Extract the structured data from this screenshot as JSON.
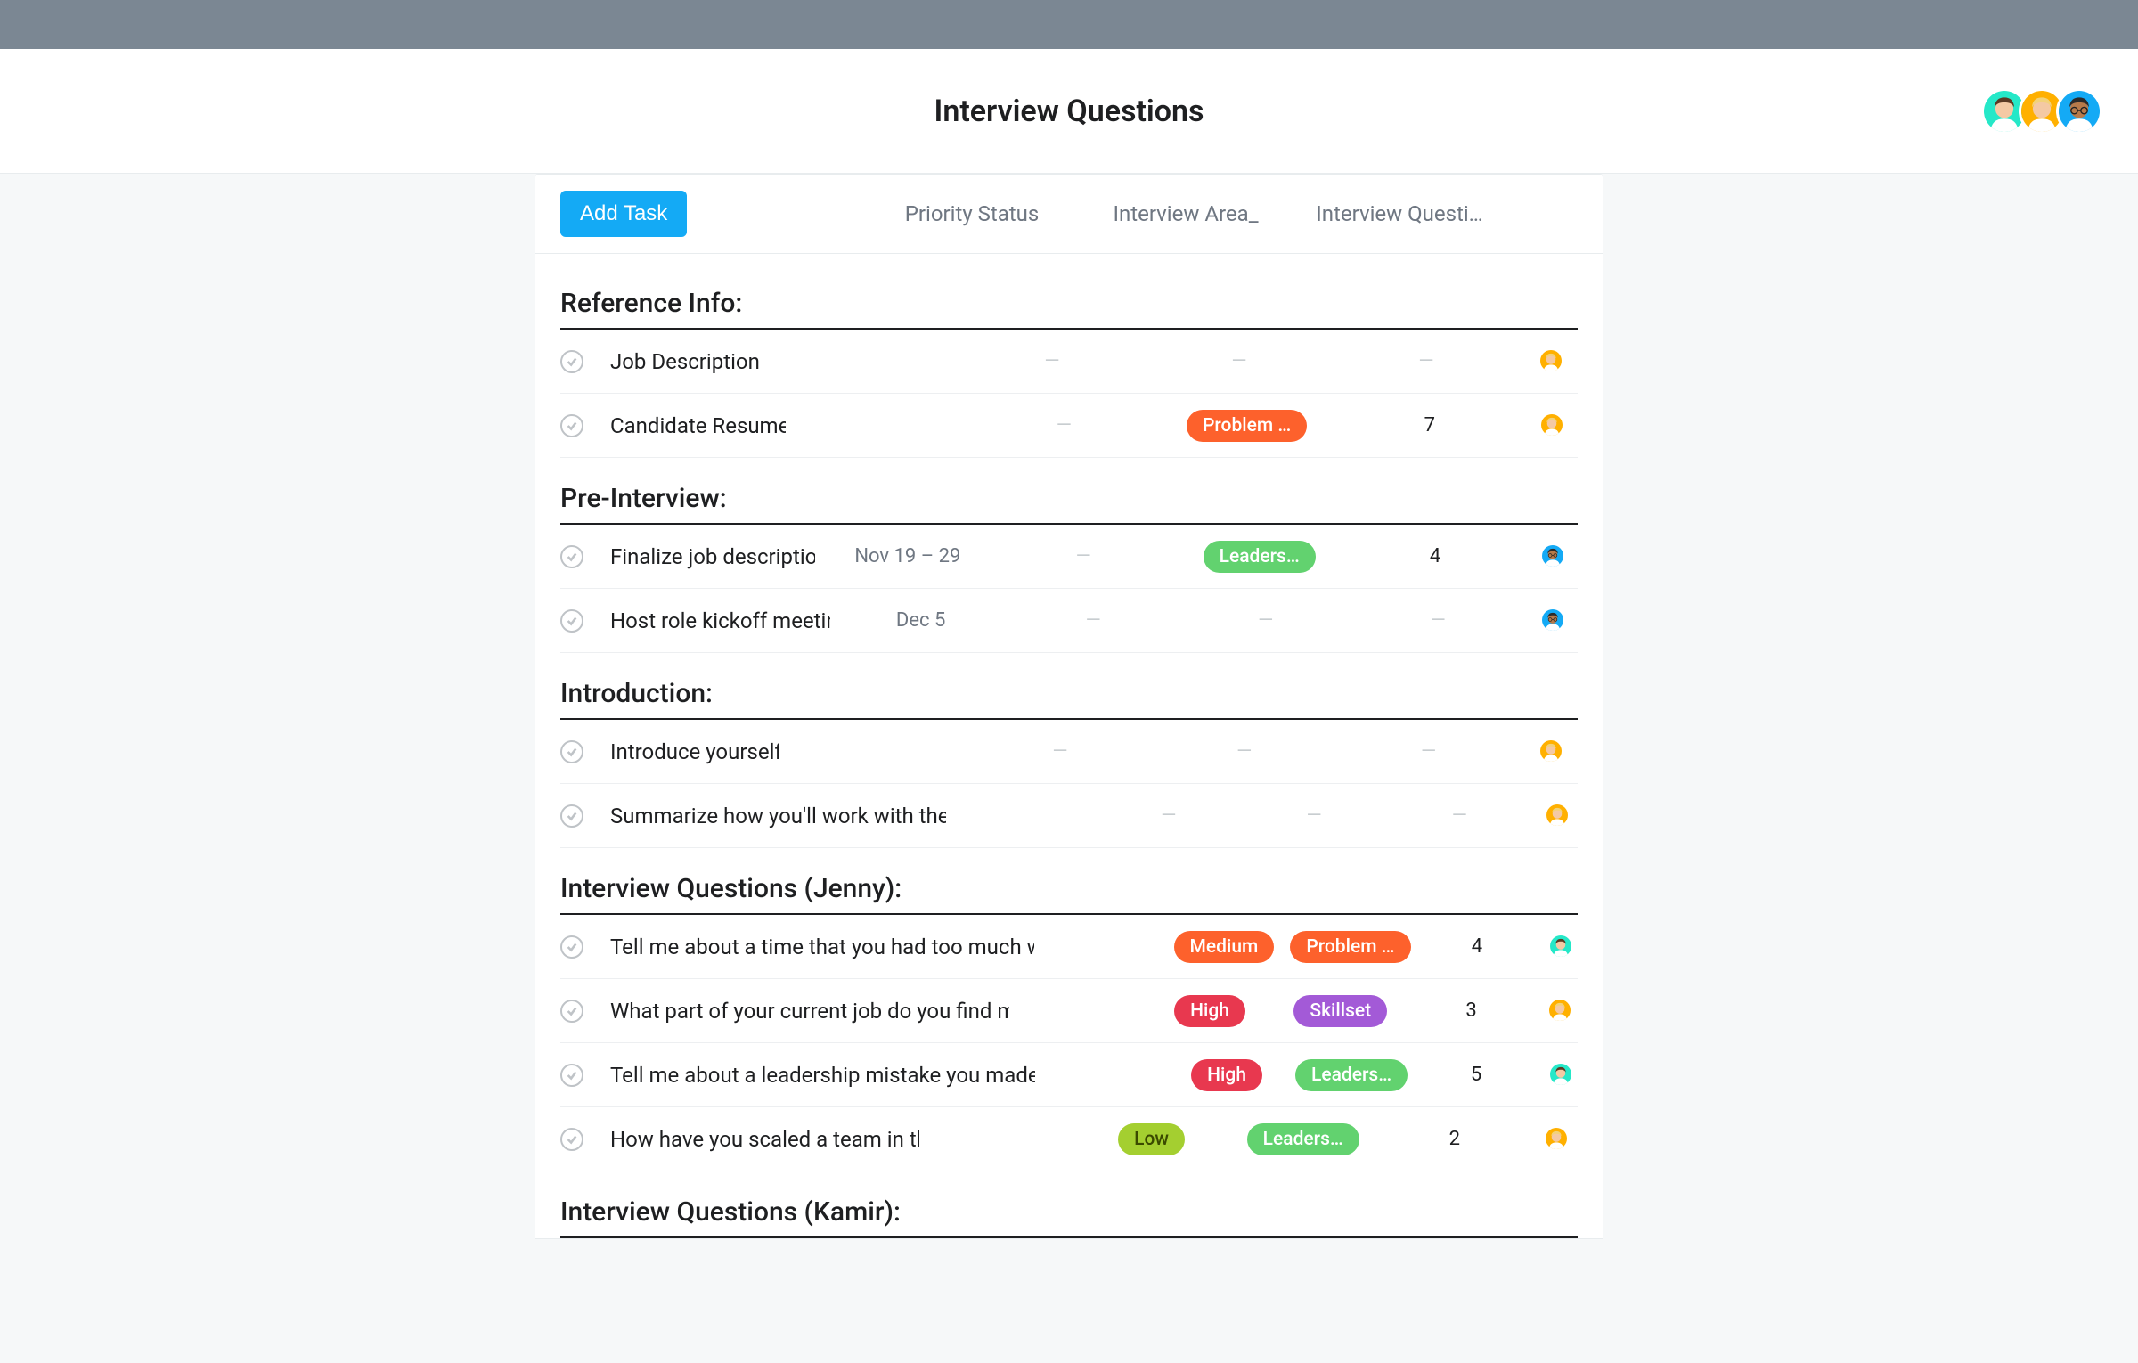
{
  "header": {
    "title": "Interview Questions",
    "collaborators": [
      "jenny",
      "nadia",
      "kamir"
    ]
  },
  "toolbar": {
    "add_task_label": "Add Task",
    "columns": {
      "priority": "Priority Status",
      "area": "Interview Area_",
      "questions": "Interview Questi…"
    }
  },
  "avatars": {
    "jenny": {
      "bg": "#25e8c8",
      "hair": "#5b3a24",
      "skin": "#f4c9a4",
      "shirt": "#ffffff"
    },
    "nadia": {
      "bg": "#ffb000",
      "hair": "#f2d27a",
      "skin": "#f4c9a4",
      "shirt": "#ffffff"
    },
    "kamir": {
      "bg": "#14aaf5",
      "hair": "#2b2b2b",
      "skin": "#b77a4a",
      "shirt": "#ffffff",
      "glasses": true
    }
  },
  "pill_colors": {
    "Medium": "c-orange",
    "High": "c-red",
    "Low": "c-lime",
    "Problem …": "c-orange",
    "Leaders…": "c-green",
    "Skillset": "c-purple"
  },
  "sections": [
    {
      "title": "Reference Info:",
      "tasks": [
        {
          "name": "Job Description",
          "date": "",
          "priority": "",
          "area": "",
          "count": "",
          "assignee": "nadia"
        },
        {
          "name": "Candidate Resume",
          "date": "",
          "priority": "",
          "area": "Problem …",
          "count": "7",
          "assignee": "nadia"
        }
      ]
    },
    {
      "title": "Pre-Interview:",
      "tasks": [
        {
          "name": "Finalize job description",
          "date": "Nov 19 – 29",
          "priority": "",
          "area": "Leaders…",
          "count": "4",
          "assignee": "kamir"
        },
        {
          "name": "Host role kickoff meeting",
          "date": "Dec 5",
          "priority": "",
          "area": "",
          "count": "",
          "assignee": "kamir"
        }
      ]
    },
    {
      "title": "Introduction:",
      "tasks": [
        {
          "name": "Introduce yourself",
          "date": "",
          "priority": "",
          "area": "",
          "count": "",
          "assignee": "nadia"
        },
        {
          "name": "Summarize how you'll work with the candidate",
          "date": "",
          "priority": "",
          "area": "",
          "count": "",
          "assignee": "nadia"
        }
      ]
    },
    {
      "title": "Interview Questions (Jenny):",
      "tasks": [
        {
          "name": "Tell me about a time that you had too much work on your plate, how d",
          "date": "",
          "priority": "Medium",
          "area": "Problem …",
          "count": "4",
          "assignee": "jenny"
        },
        {
          "name": "What part of your current job do you find most fulfilling? Why?",
          "date": "",
          "priority": "High",
          "area": "Skillset",
          "count": "3",
          "assignee": "nadia"
        },
        {
          "name": "Tell me about a leadership mistake you made in the last year. What di",
          "date": "",
          "priority": "High",
          "area": "Leaders…",
          "count": "5",
          "assignee": "jenny"
        },
        {
          "name": "How have you scaled a team in the past?",
          "date": "",
          "priority": "Low",
          "area": "Leaders…",
          "count": "2",
          "assignee": "nadia"
        }
      ]
    },
    {
      "title": "Interview Questions (Kamir):",
      "tasks": []
    }
  ]
}
